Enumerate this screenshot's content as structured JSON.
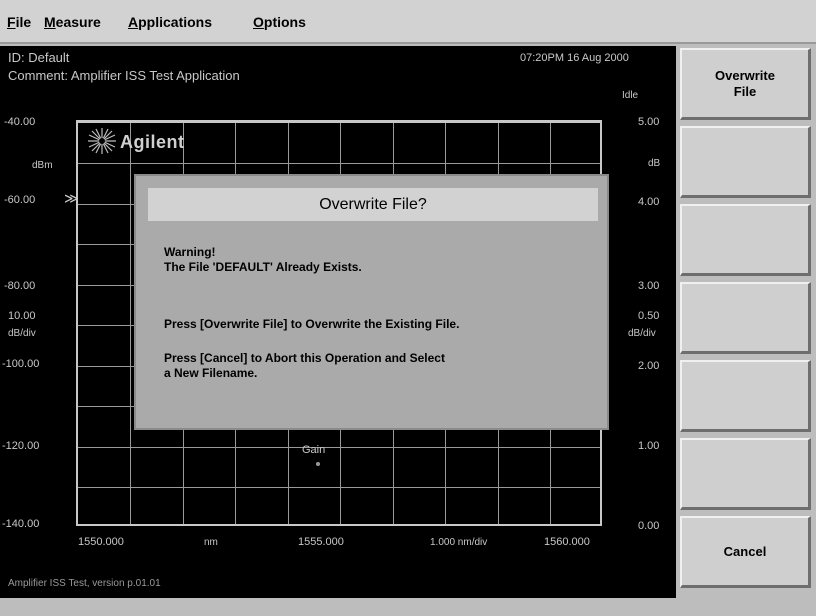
{
  "menu": {
    "items": [
      {
        "label": "File",
        "underline": "F",
        "rest": "ile"
      },
      {
        "label": "Measure",
        "underline": "M",
        "rest": "easure"
      },
      {
        "label": "Applications",
        "underline": "A",
        "rest": "pplications"
      },
      {
        "label": "Options",
        "underline": "O",
        "rest": "ptions"
      }
    ]
  },
  "header": {
    "id_text": "ID: Default",
    "comment_text": "Comment: Amplifier ISS Test Application",
    "datetime": "07:20PM 16 Aug 2000",
    "status": "Idle"
  },
  "left_axis": {
    "labels": [
      "-40.00",
      "dBm",
      "-60.00",
      "-80.00",
      "10.00",
      "dB/div",
      "-100.00",
      "-120.00",
      "-140.00"
    ]
  },
  "right_axis": {
    "labels": [
      "5.00",
      "dB",
      "4.00",
      "3.00",
      "0.50",
      "dB/div",
      "2.00",
      "1.00",
      "0.00"
    ]
  },
  "x_axis": {
    "start": "1550.000",
    "unit": "nm",
    "center": "1555.000",
    "scale": "1.000 nm/div",
    "stop": "1560.000"
  },
  "trace": {
    "label": "Gain",
    "marker_glyph": "≫"
  },
  "logo": {
    "text": "Agilent"
  },
  "dialog": {
    "title": "Overwrite File?",
    "line1": "Warning!",
    "line2": "The File 'DEFAULT' Already Exists.",
    "line3": "Press [Overwrite File] to Overwrite the Existing File.",
    "line4": "Press [Cancel] to Abort this Operation and Select",
    "line5": "a New Filename."
  },
  "softkeys": [
    {
      "label": "Overwrite\nFile"
    },
    {
      "label": ""
    },
    {
      "label": ""
    },
    {
      "label": ""
    },
    {
      "label": ""
    },
    {
      "label": ""
    },
    {
      "label": "Cancel"
    }
  ],
  "footer": {
    "version": "Amplifier ISS Test, version p.01.01"
  }
}
